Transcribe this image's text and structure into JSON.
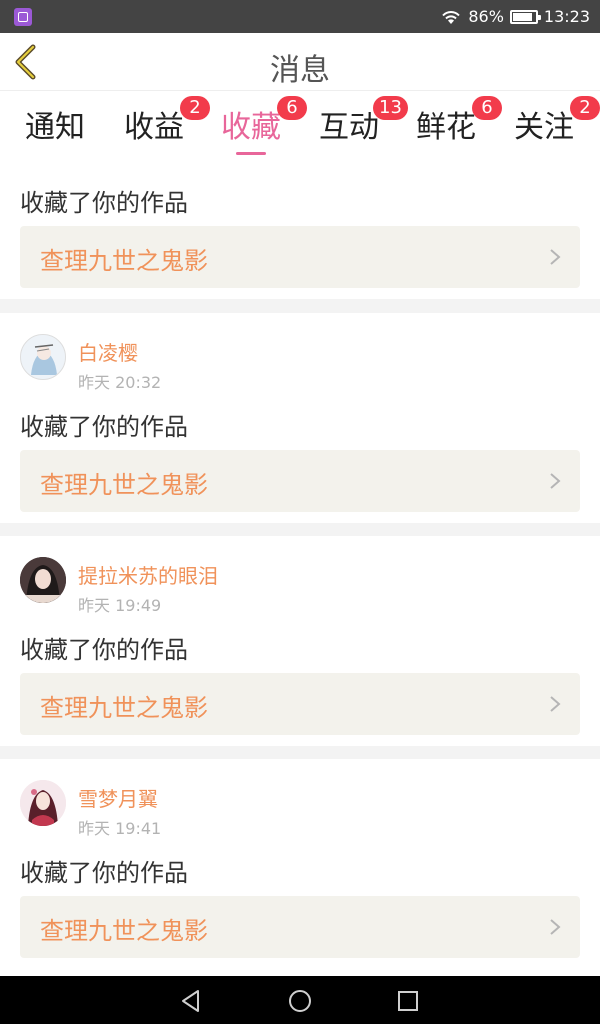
{
  "status_bar": {
    "battery": "86%",
    "time": "13:23"
  },
  "header": {
    "title": "消息"
  },
  "tabs": [
    {
      "label": "通知",
      "badge": ""
    },
    {
      "label": "收益",
      "badge": "2"
    },
    {
      "label": "收藏",
      "badge": "6",
      "active": true
    },
    {
      "label": "互动",
      "badge": "13"
    },
    {
      "label": "鲜花",
      "badge": "6"
    },
    {
      "label": "关注",
      "badge": "2"
    }
  ],
  "feed": {
    "partial_item": {
      "action": "收藏了你的作品",
      "work_title": "查理九世之鬼影"
    },
    "items": [
      {
        "username": "白凌樱",
        "time": "昨天 20:32",
        "action": "收藏了你的作品",
        "work_title": "查理九世之鬼影"
      },
      {
        "username": "提拉米苏的眼泪",
        "time": "昨天 19:49",
        "action": "收藏了你的作品",
        "work_title": "查理九世之鬼影"
      },
      {
        "username": "雪梦月翼",
        "time": "昨天 19:41",
        "action": "收藏了你的作品",
        "work_title": "查理九世之鬼影"
      }
    ]
  },
  "colors": {
    "accent": "#e8669a",
    "badge": "#f23b4b",
    "username": "#f0925a",
    "work_box": "#f3f2ec"
  }
}
